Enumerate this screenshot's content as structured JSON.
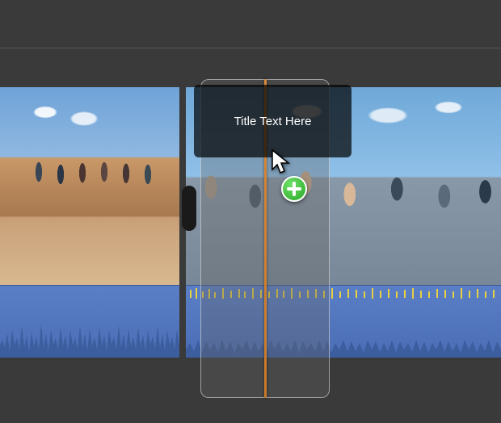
{
  "toolbar": {},
  "timeline": {
    "clips": [
      {
        "scene": "desert-group",
        "audio_color": "#5b7fc7"
      },
      {
        "scene": "beach-group",
        "audio_color": "#5b7fc7"
      }
    ],
    "transition": {
      "present": true
    },
    "playhead": {
      "visible": true
    }
  },
  "drag": {
    "type": "title",
    "preview_text": "Title Text Here",
    "overlay_visible": true,
    "add_badge": "plus"
  },
  "cursor": {
    "type": "arrow"
  },
  "colors": {
    "background": "#3a3a3a",
    "audio_track": "#5b7fc7",
    "playhead": "#d88a3a",
    "add_badge": "#3abf38"
  }
}
